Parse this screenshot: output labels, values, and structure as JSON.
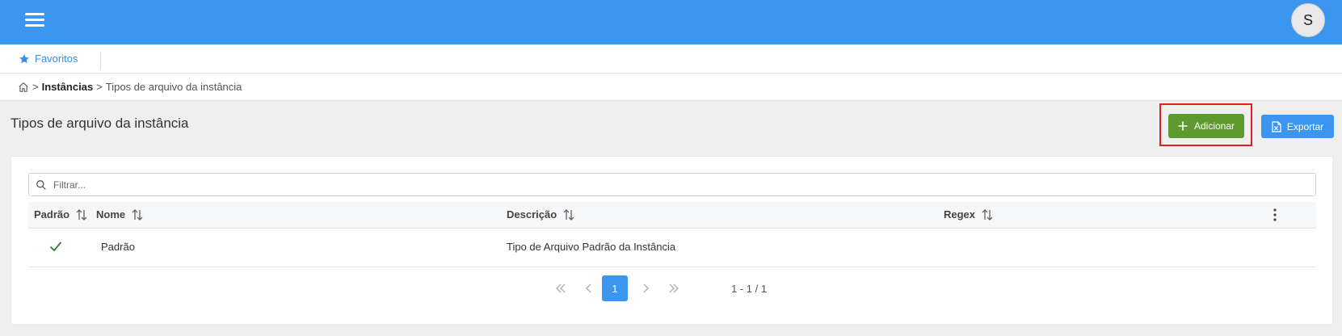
{
  "header": {
    "user_initial": "S"
  },
  "favorites": {
    "label": "Favoritos"
  },
  "breadcrumb": {
    "parent": "Instâncias",
    "current": "Tipos de arquivo da instância",
    "separator": ">"
  },
  "page": {
    "title": "Tipos de arquivo da instância",
    "add_label": "Adicionar",
    "export_label": "Exportar"
  },
  "filter": {
    "placeholder": "Filtrar...",
    "value": ""
  },
  "table": {
    "columns": [
      "Padrão",
      "Nome",
      "Descrição",
      "Regex"
    ],
    "rows": [
      {
        "padrao": "check",
        "nome": "Padrão",
        "descricao": "Tipo de Arquivo Padrão da Instância",
        "regex": ""
      }
    ]
  },
  "pagination": {
    "current_page": "1",
    "info": "1 - 1 / 1"
  },
  "colors": {
    "header_bg": "#3a96ee",
    "add_button": "#5e9a2f",
    "highlight_border": "#e02020"
  }
}
